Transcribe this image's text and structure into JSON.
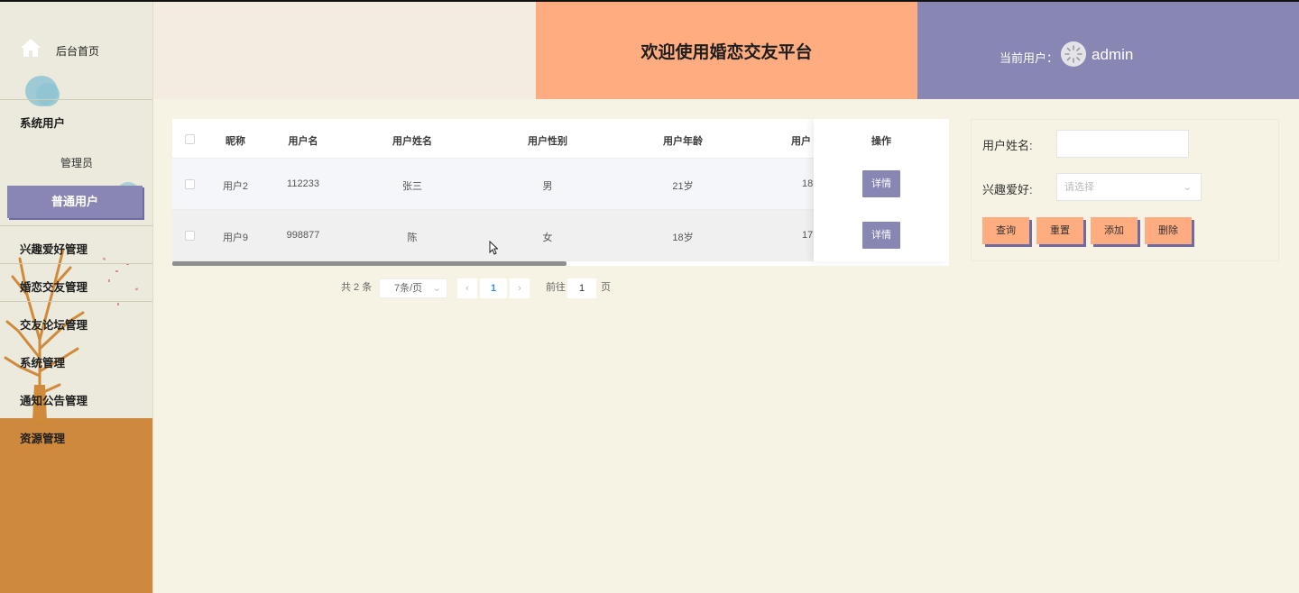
{
  "sidebar": {
    "home_label": "后台首页",
    "items": [
      {
        "label": "系统用户"
      },
      {
        "label": "兴趣爱好管理"
      },
      {
        "label": "婚恋交友管理"
      },
      {
        "label": "交友论坛管理"
      },
      {
        "label": "系统管理"
      },
      {
        "label": "通知公告管理"
      },
      {
        "label": "资源管理"
      }
    ],
    "sub_items": [
      {
        "label": "管理员"
      },
      {
        "label": "普通用户"
      }
    ]
  },
  "header": {
    "title": "欢迎使用婚恋交友平台",
    "current_user_label": "当前用户：",
    "username": "admin"
  },
  "table": {
    "columns": [
      "昵称",
      "用户名",
      "用户姓名",
      "用户性别",
      "用户年龄",
      "用户",
      "操作"
    ],
    "rows": [
      {
        "nickname": "用户2",
        "username": "112233",
        "name": "张三",
        "gender": "男",
        "age": "21岁",
        "extra": "18",
        "action": "详情"
      },
      {
        "nickname": "用户9",
        "username": "998877",
        "name": "陈",
        "gender": "女",
        "age": "18岁",
        "extra": "17",
        "action": "详情"
      }
    ]
  },
  "pagination": {
    "total": "共 2 条",
    "page_size": "7条/页",
    "current_page": "1",
    "goto_label": "前往",
    "goto_value": "1",
    "goto_suffix": "页"
  },
  "search": {
    "name_label": "用户姓名:",
    "name_value": "",
    "hobby_label": "兴趣爱好:",
    "hobby_placeholder": "请选择",
    "buttons": {
      "query": "查询",
      "reset": "重置",
      "add": "添加",
      "delete": "删除"
    }
  },
  "colors": {
    "accent_purple": "#8886b3",
    "accent_orange": "#ffac80",
    "sidebar_orange": "#cf893d",
    "link_blue": "#3b8de0"
  }
}
